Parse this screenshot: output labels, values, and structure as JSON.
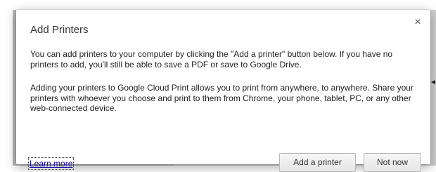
{
  "dialog": {
    "title": "Add Printers",
    "close_glyph": "×",
    "paragraph_1": "You can add printers to your computer by clicking the \"Add a printer\" button below. If you have no printers to add, you'll still be able to save a PDF or save to Google Drive.",
    "paragraph_2": "Adding your printers to Google Cloud Print allows you to print from anywhere, to anywhere. Share your printers with whoever you choose and print to them from Chrome, your phone, tablet, PC, or any other web-connected device.",
    "learn_more_label": "Learn more",
    "add_printer_label": "Add a printer",
    "not_now_label": "Not now"
  },
  "icons": {
    "close": "close-icon",
    "arrow": "arrow-left-icon"
  },
  "colors": {
    "link": "#1a0dab",
    "overlay_left": "#b9b9b9",
    "overlay_right": "#d0d0d0"
  }
}
